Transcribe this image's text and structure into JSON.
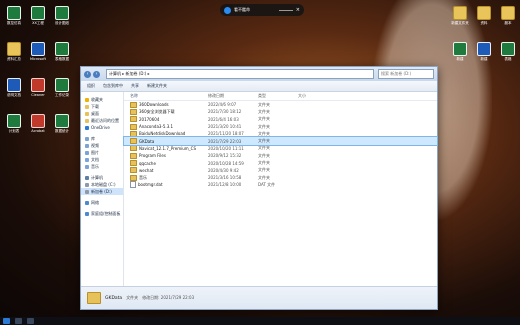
{
  "desktop": {
    "search_pill": {
      "label": "看不鑑命"
    },
    "left_icons": [
      {
        "label": "数控仿真",
        "type": "x"
      },
      {
        "label": "XX工程",
        "type": "x"
      },
      {
        "label": "设计图纸",
        "type": "x"
      },
      {
        "label": "资料汇总",
        "type": "f"
      },
      {
        "label": "Microsoft",
        "type": "w"
      },
      {
        "label": "表格数据",
        "type": "x"
      },
      {
        "label": "说明文档",
        "type": "w"
      },
      {
        "label": "Cleaner",
        "type": "r"
      },
      {
        "label": "工作记录",
        "type": "x"
      },
      {
        "label": "计划表",
        "type": "x"
      },
      {
        "label": "Acrobat",
        "type": "r"
      },
      {
        "label": "数据统计",
        "type": "x"
      }
    ],
    "right_icons": [
      {
        "label": "新建文件夹",
        "type": "f"
      },
      {
        "label": "资料",
        "type": "f"
      },
      {
        "label": "副本",
        "type": "f"
      },
      {
        "label": "新建",
        "type": "x"
      },
      {
        "label": "新建",
        "type": "w"
      },
      {
        "label": "表格",
        "type": "x"
      }
    ]
  },
  "explorer": {
    "address": "计算机 ▸ 新加卷 (D:) ▸",
    "search_placeholder": "搜索 新加卷 (D:)",
    "toolbar": [
      "组织",
      "包含到库中",
      "共享",
      "新建文件夹"
    ],
    "columns": {
      "name": "名称",
      "date": "修改日期",
      "type": "类型",
      "size": "大小"
    },
    "sidebar": [
      {
        "label": "收藏夹",
        "icon": "star"
      },
      {
        "label": "下载",
        "icon": "folder"
      },
      {
        "label": "桌面",
        "icon": "folder"
      },
      {
        "label": "最近访问的位置",
        "icon": "folder"
      },
      {
        "label": "OneDrive",
        "icon": "cloud"
      },
      {
        "label": "",
        "icon": "gap"
      },
      {
        "label": "库",
        "icon": "lib"
      },
      {
        "label": "视频",
        "icon": "lib"
      },
      {
        "label": "图片",
        "icon": "lib"
      },
      {
        "label": "文档",
        "icon": "lib"
      },
      {
        "label": "音乐",
        "icon": "lib"
      },
      {
        "label": "",
        "icon": "gap"
      },
      {
        "label": "计算机",
        "icon": "pc"
      },
      {
        "label": "本地磁盘 (C:)",
        "icon": "disk"
      },
      {
        "label": "新加卷 (D:)",
        "icon": "disk",
        "selected": true
      },
      {
        "label": "",
        "icon": "gap"
      },
      {
        "label": "网络",
        "icon": "net"
      },
      {
        "label": "",
        "icon": "gap"
      },
      {
        "label": "家庭组/控制面板",
        "icon": "net"
      }
    ],
    "files": [
      {
        "name": "360Downloads",
        "date": "2022/4/6 9:07",
        "type": "文件夹",
        "size": "",
        "kind": "folder"
      },
      {
        "name": "360安全浏览器下载",
        "date": "2021/7/30 18:12",
        "type": "文件夹",
        "size": "",
        "kind": "folder"
      },
      {
        "name": "20170604",
        "date": "2021/6/4 16:03",
        "type": "文件夹",
        "size": "",
        "kind": "folder"
      },
      {
        "name": "Anaconda3-5.3.1",
        "date": "2021/3/20 10:41",
        "type": "文件夹",
        "size": "",
        "kind": "folder"
      },
      {
        "name": "BaiduNetdiskDownload",
        "date": "2021/11/20 18:07",
        "type": "文件夹",
        "size": "",
        "kind": "folder"
      },
      {
        "name": "GKData",
        "date": "2021/7/29 22:03",
        "type": "文件夹",
        "size": "",
        "kind": "folder",
        "selected": true
      },
      {
        "name": "Navicat_12.1.7_Premium_CS",
        "date": "2020/10/20 11:11",
        "type": "文件夹",
        "size": "",
        "kind": "folder"
      },
      {
        "name": "Program Files",
        "date": "2020/9/12 15:32",
        "type": "文件夹",
        "size": "",
        "kind": "folder"
      },
      {
        "name": "qqcache",
        "date": "2020/10/28 14:59",
        "type": "文件夹",
        "size": "",
        "kind": "folder"
      },
      {
        "name": "wechat",
        "date": "2020/4/30 9:42",
        "type": "文件夹",
        "size": "",
        "kind": "folder"
      },
      {
        "name": "音乐",
        "date": "2021/3/16 10:58",
        "type": "文件夹",
        "size": "",
        "kind": "folder"
      },
      {
        "name": "bootmgr.dat",
        "date": "2021/12/8 10:00",
        "type": "DAT 文件",
        "size": "",
        "kind": "file"
      }
    ],
    "status": {
      "name": "GKData",
      "meta": "修改日期: 2021/7/29 22:03",
      "kind": "文件夹"
    }
  },
  "colors": {
    "accent": "#2b7bd6",
    "selection": "#cde8ff"
  }
}
